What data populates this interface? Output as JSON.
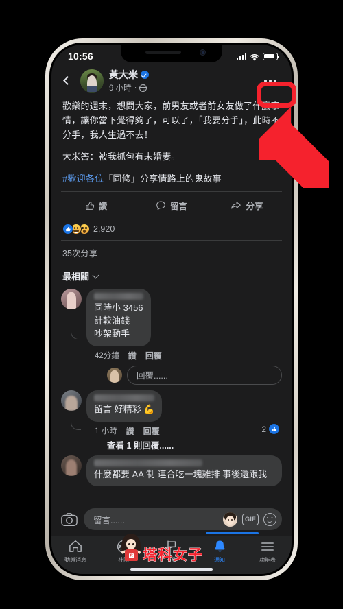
{
  "status_bar": {
    "time": "10:56",
    "icons": [
      "cellular-signal-icon",
      "wifi-icon",
      "battery-icon"
    ]
  },
  "post": {
    "back_icon": "back-chevron-icon",
    "author_name": "黃大米",
    "verified_badge": "verified-badge-icon",
    "timestamp": "9 小時",
    "privacy_separator": "·",
    "privacy_icon": "globe-icon",
    "more_options_icon": "ellipsis-icon",
    "paragraphs": [
      "歡樂的週末，想問大家，前男友或者前女友做了什麼事情，讓你當下覺得夠了，可以了，「我要分手」，此時不分手，我人生過不去！",
      "大米答：被我抓包有未婚妻。"
    ],
    "hashtag": "#歡迎各位",
    "hashtag_rest": "「同修」分享情路上的鬼故事"
  },
  "actions": [
    {
      "label": "讚",
      "icon": "thumbs-up-icon"
    },
    {
      "label": "留言",
      "icon": "comment-bubble-icon"
    },
    {
      "label": "分享",
      "icon": "share-arrow-icon"
    }
  ],
  "reactions": {
    "types": [
      "like-reaction-icon",
      "haha-reaction-icon",
      "wow-reaction-icon"
    ],
    "count": "2,920"
  },
  "shares_text": "35次分享",
  "sort": {
    "label": "最相關",
    "chevron_icon": "chevron-down-icon"
  },
  "comments": [
    {
      "author_blurred": true,
      "text_lines": [
        "同時小 3456",
        "計較油錢",
        "吵架動手"
      ],
      "time": "42分鐘",
      "like_label": "讚",
      "reply_label": "回覆",
      "reply_box_placeholder": "回覆......",
      "avatar": "commenter-avatar-1"
    },
    {
      "author_blurred": true,
      "text_lines": [
        "留言 好精彩 💪"
      ],
      "time": "1 小時",
      "like_label": "讚",
      "reply_label": "回覆",
      "like_count": "2",
      "like_badge_icon": "like-badge-icon",
      "view_replies": "查看 1 則回覆......",
      "avatar": "commenter-avatar-2"
    },
    {
      "author_blurred": true,
      "text_lines": [
        "什麼都要 AA 制 連合吃一塊雞排 事後還跟我"
      ],
      "avatar": "commenter-avatar-3"
    }
  ],
  "composer": {
    "camera_icon": "camera-icon",
    "placeholder": "留言......",
    "sticker_icon": "avatar-sticker-icon",
    "gif_label": "GIF",
    "gif_icon": "gif-icon",
    "emoji_icon": "smiley-icon"
  },
  "bottom_nav": [
    {
      "label": "動態消息",
      "icon": "home-icon",
      "active": false
    },
    {
      "label": "社團",
      "icon": "groups-icon",
      "active": false
    },
    {
      "label": "市集",
      "icon": "marketplace-flag-icon",
      "active": false
    },
    {
      "label": "通知",
      "icon": "bell-icon",
      "active": true
    },
    {
      "label": "功能表",
      "icon": "hamburger-menu-icon",
      "active": false
    }
  ],
  "annotation": {
    "highlight_color": "#f5222d",
    "highlight_target": "ellipsis-more-options-button",
    "arrow_icon": "red-pointer-arrow"
  },
  "watermark": {
    "text": "塔科女子",
    "color": "#f5222d",
    "mascot_icon": "mascot-girl-icon"
  },
  "colors": {
    "screen_bg": "#1c1c1d",
    "bubble_bg": "#3a3b3c",
    "primary_text": "#e4e6eb",
    "secondary_text": "#b0b3b8",
    "accent_blue": "#1b74e4",
    "link_blue": "#5c9bee"
  }
}
